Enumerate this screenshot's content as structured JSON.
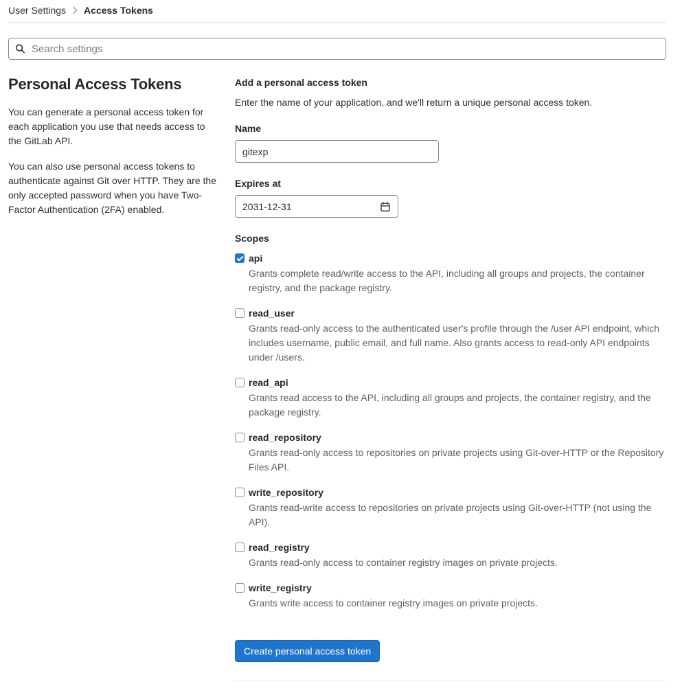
{
  "breadcrumb": {
    "parent": "User Settings",
    "current": "Access Tokens"
  },
  "search": {
    "placeholder": "Search settings"
  },
  "sidebar": {
    "title": "Personal Access Tokens",
    "paragraph1": "You can generate a personal access token for each application you use that needs access to the GitLab API.",
    "paragraph2": "You can also use personal access tokens to authenticate against Git over HTTP. They are the only accepted password when you have Two-Factor Authentication (2FA) enabled."
  },
  "form": {
    "heading": "Add a personal access token",
    "description": "Enter the name of your application, and we'll return a unique personal access token.",
    "name_label": "Name",
    "name_value": "gitexp",
    "expires_label": "Expires at",
    "expires_value": "2031-12-31",
    "scopes_label": "Scopes",
    "scopes": [
      {
        "label": "api",
        "checked": "true",
        "description": "Grants complete read/write access to the API, including all groups and projects, the container registry, and the package registry."
      },
      {
        "label": "read_user",
        "checked": "false",
        "description": "Grants read-only access to the authenticated user's profile through the /user API endpoint, which includes username, public email, and full name. Also grants access to read-only API endpoints under /users."
      },
      {
        "label": "read_api",
        "checked": "false",
        "description": "Grants read access to the API, including all groups and projects, the container registry, and the package registry."
      },
      {
        "label": "read_repository",
        "checked": "false",
        "description": "Grants read-only access to repositories on private projects using Git-over-HTTP or the Repository Files API."
      },
      {
        "label": "write_repository",
        "checked": "false",
        "description": "Grants read-write access to repositories on private projects using Git-over-HTTP (not using the API)."
      },
      {
        "label": "read_registry",
        "checked": "false",
        "description": "Grants read-only access to container registry images on private projects."
      },
      {
        "label": "write_registry",
        "checked": "false",
        "description": "Grants write access to container registry images on private projects."
      }
    ],
    "submit_label": "Create personal access token"
  },
  "colors": {
    "accent": "#1f75cb",
    "accent_border": "#1068bf",
    "input_border": "#89888d",
    "divider": "#e5e5e5",
    "text": "#303030",
    "muted": "#5e5e5e"
  }
}
